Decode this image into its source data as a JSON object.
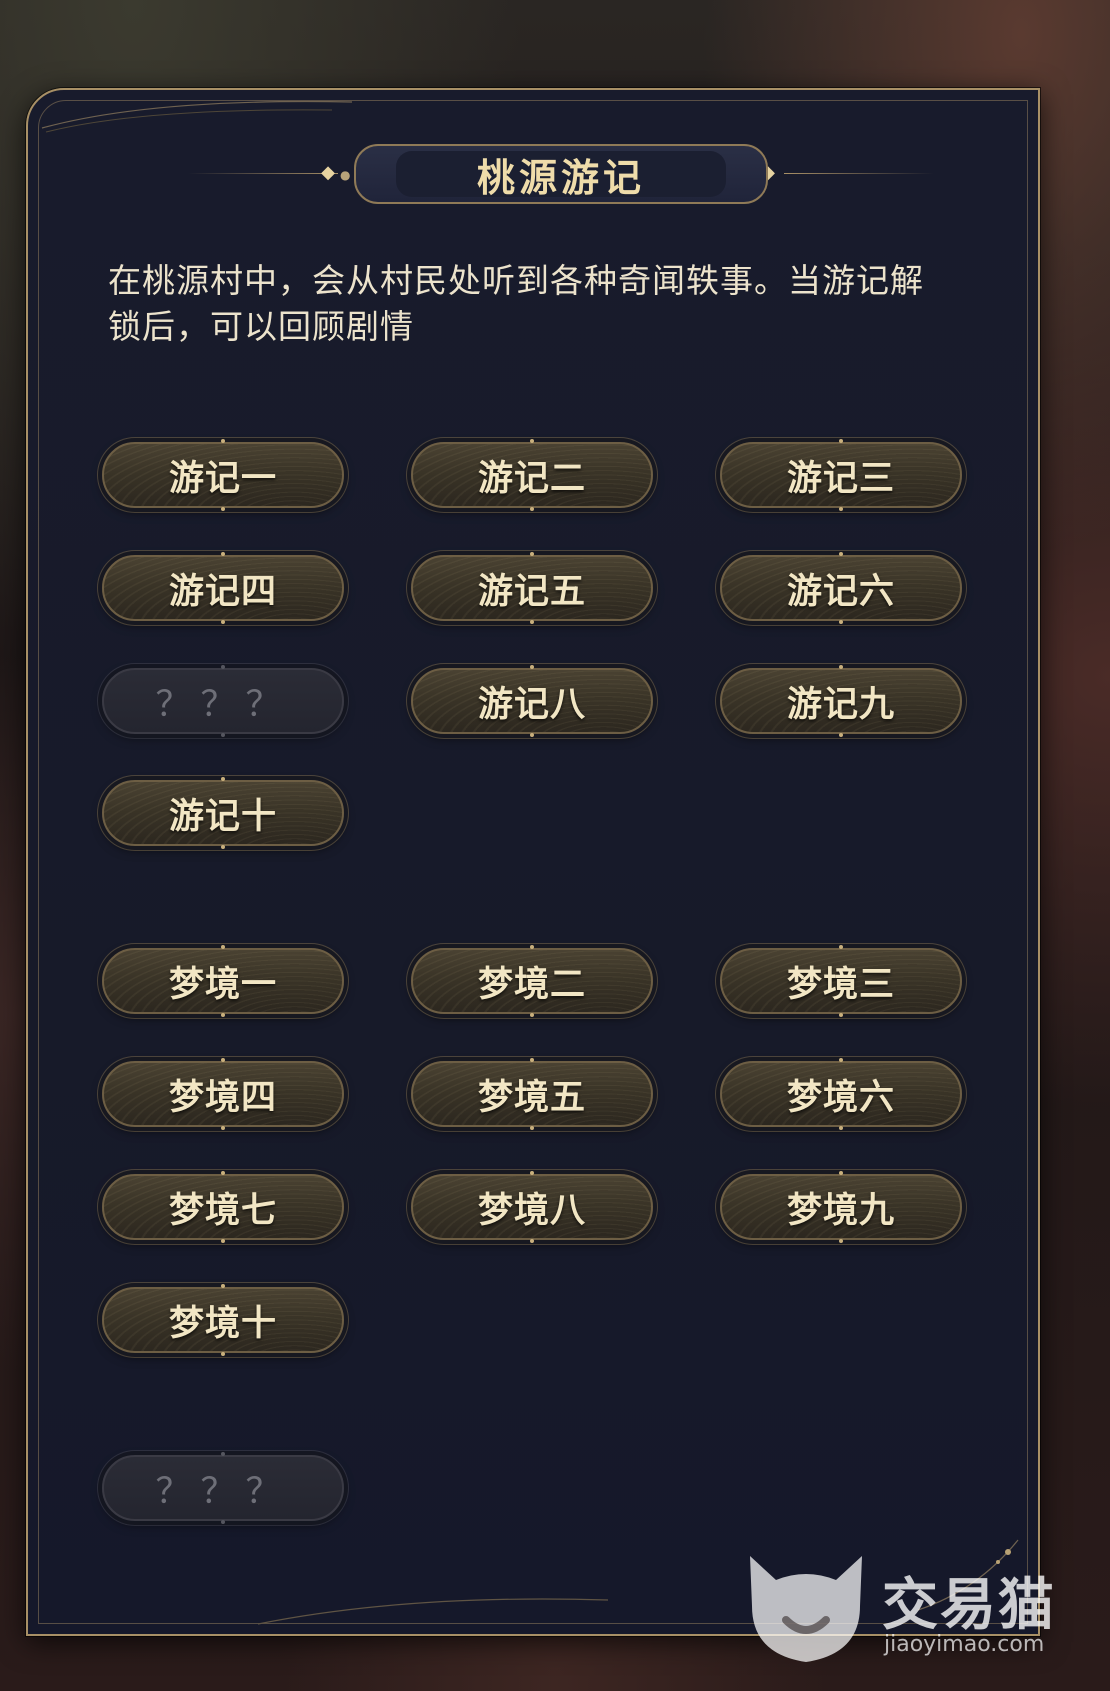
{
  "panel": {
    "title": "桃源游记",
    "description": "在桃源村中，会从村民处听到各种奇闻轶事。当游记解锁后，可以回顾剧情"
  },
  "travel_notes": [
    {
      "label": "游记一",
      "locked": false
    },
    {
      "label": "游记二",
      "locked": false
    },
    {
      "label": "游记三",
      "locked": false
    },
    {
      "label": "游记四",
      "locked": false
    },
    {
      "label": "游记五",
      "locked": false
    },
    {
      "label": "游记六",
      "locked": false
    },
    {
      "label": "？？？",
      "locked": true
    },
    {
      "label": "游记八",
      "locked": false
    },
    {
      "label": "游记九",
      "locked": false
    },
    {
      "label": "游记十",
      "locked": false
    }
  ],
  "dreams": [
    {
      "label": "梦境一",
      "locked": false
    },
    {
      "label": "梦境二",
      "locked": false
    },
    {
      "label": "梦境三",
      "locked": false
    },
    {
      "label": "梦境四",
      "locked": false
    },
    {
      "label": "梦境五",
      "locked": false
    },
    {
      "label": "梦境六",
      "locked": false
    },
    {
      "label": "梦境七",
      "locked": false
    },
    {
      "label": "梦境八",
      "locked": false
    },
    {
      "label": "梦境九",
      "locked": false
    },
    {
      "label": "梦境十",
      "locked": false
    }
  ],
  "extra": [
    {
      "label": "？？？",
      "locked": true
    }
  ],
  "watermark": {
    "brand": "交易猫",
    "url": "jiaoyimao.com"
  }
}
